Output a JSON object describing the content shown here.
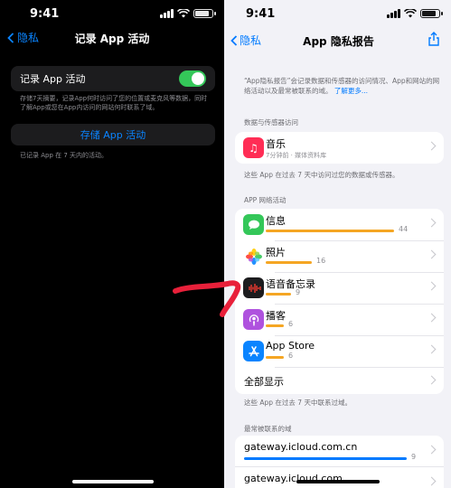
{
  "left": {
    "status": {
      "time": "9:41"
    },
    "nav": {
      "back_label": "隐私",
      "title": "记录 App 活动"
    },
    "toggle_row": {
      "label": "记录 App 活动",
      "on": true
    },
    "description": "存储7天摘要，记录App何时访问了您的位置或麦克风等数据，同时了解App或您在App内访问的网站何时联系了域。",
    "save_button": "存储 App 活动",
    "footnote": "已记录 App 在 7 天内的活动。"
  },
  "right": {
    "status": {
      "time": "9:41"
    },
    "nav": {
      "back_label": "隐私",
      "title": "App 隐私报告"
    },
    "intro": "“App隐私报告”会记录数据和传感器的访问情况、App和网站的网络活动以及最常被联系的域。",
    "intro_link": "了解更多...",
    "sensor_section": {
      "header": "数据与传感器访问",
      "items": [
        {
          "name": "音乐",
          "subtitle": "7分钟前 · 媒体资料库",
          "icon": "music-icon",
          "color": "#ff2d55"
        }
      ],
      "footer": "这些 App 在过去 7 天中访问过您的数据或传感器。"
    },
    "network_section": {
      "header": "APP 网络活动",
      "items": [
        {
          "name": "信息",
          "count": "44",
          "fraction": 1.0,
          "icon": "messages-icon",
          "color": "#34c759"
        },
        {
          "name": "照片",
          "count": "16",
          "fraction": 0.36,
          "icon": "photos-icon",
          "color": "#ff9500"
        },
        {
          "name": "语音备忘录",
          "count": "9",
          "fraction": 0.2,
          "icon": "voice-memos-icon",
          "color": "#1c1c1e"
        },
        {
          "name": "播客",
          "count": "6",
          "fraction": 0.14,
          "icon": "podcasts-icon",
          "color": "#af52de"
        },
        {
          "name": "App Store",
          "count": "6",
          "fraction": 0.14,
          "icon": "app-store-icon",
          "color": "#0a84ff"
        }
      ],
      "show_all": "全部显示",
      "footer": "这些 App 在过去 7 天中联系过域。"
    },
    "domains_section": {
      "header": "最常被联系的域",
      "items": [
        {
          "name": "gateway.icloud.com.cn",
          "count": "9",
          "fraction": 1.0
        },
        {
          "name": "gateway.icloud.com",
          "count": "",
          "fraction": 0.9
        }
      ]
    }
  },
  "annotation": {
    "color": "#e8203a"
  }
}
